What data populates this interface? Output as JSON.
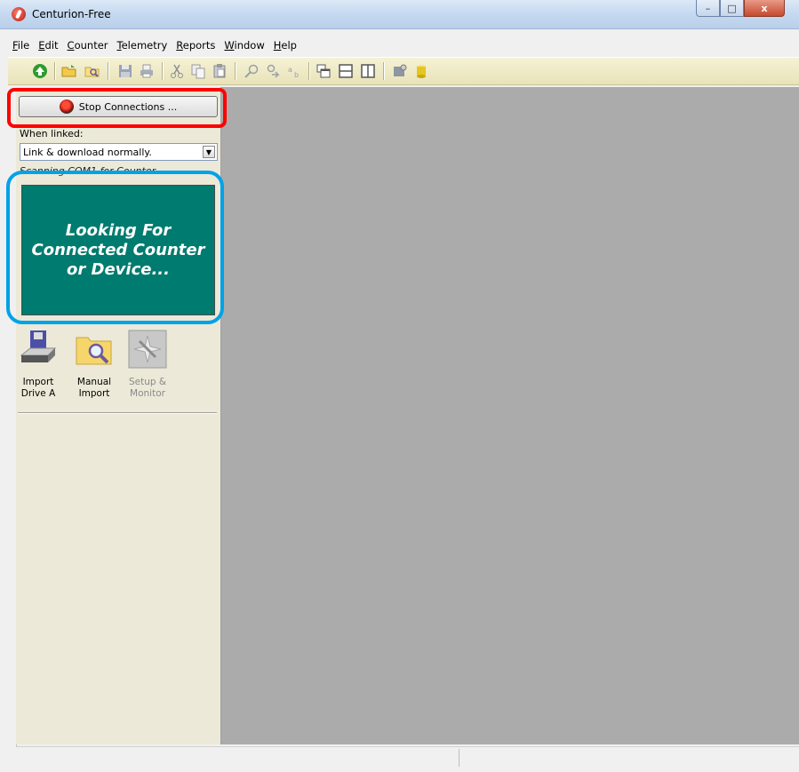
{
  "window": {
    "title": "Centurion-Free"
  },
  "caption_buttons": {
    "minimize": "–",
    "maximize": "□",
    "close": "x"
  },
  "menu": [
    {
      "label": "File",
      "u": "F",
      "rest": "ile"
    },
    {
      "label": "Edit",
      "u": "E",
      "rest": "dit"
    },
    {
      "label": "Counter",
      "u": "C",
      "rest": "ounter"
    },
    {
      "label": "Telemetry",
      "u": "T",
      "rest": "elemetry"
    },
    {
      "label": "Reports",
      "u": "R",
      "rest": "eports"
    },
    {
      "label": "Window",
      "u": "W",
      "rest": "indow"
    },
    {
      "label": "Help",
      "u": "H",
      "rest": "elp"
    }
  ],
  "toolbar": {
    "icons": [
      "up-arrow-icon",
      "open-folder-icon",
      "search-folder-icon",
      "save-icon",
      "print-icon",
      "cut-icon",
      "copy-icon",
      "paste-icon",
      "find-icon",
      "find-next-icon",
      "replace-icon",
      "cascade-icon",
      "tile-horizontal-icon",
      "tile-vertical-icon",
      "settings-icon",
      "database-icon"
    ]
  },
  "panel": {
    "stop_button": "Stop Connections ...",
    "when_linked_label": "When linked:",
    "link_select_value": "Link & download normally.",
    "scan_text": "Scanning COM1 for Counter...",
    "status_lines": [
      "Looking For",
      "Connected Counter",
      "or Device..."
    ],
    "status_color": "#007b6f",
    "tools": [
      {
        "line1": "Import",
        "line2": "Drive A",
        "icon": "drive-icon"
      },
      {
        "line1": "Manual",
        "line2": "Import",
        "icon": "folder-search-icon"
      },
      {
        "line1": "Setup &",
        "line2": "Monitor",
        "icon": "wand-icon"
      }
    ]
  },
  "colors": {
    "highlight_red": "#ff0000",
    "highlight_blue": "#00a2e8",
    "workspace": "#ababab"
  }
}
